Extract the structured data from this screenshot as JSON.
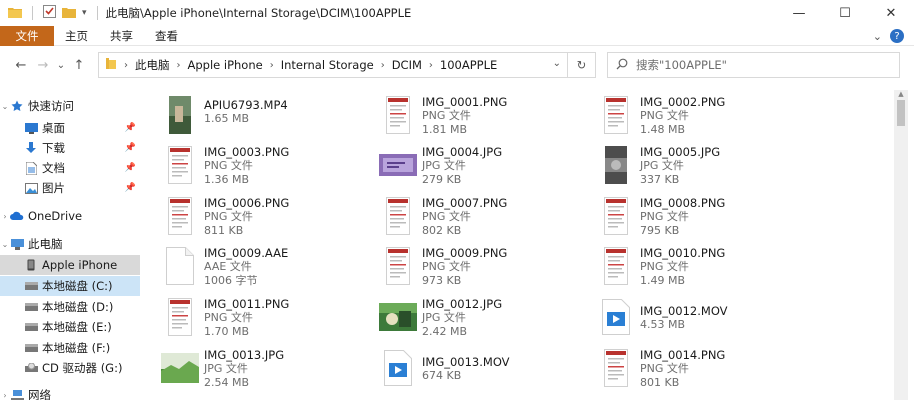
{
  "window": {
    "title": "此电脑\\Apple iPhone\\Internal Storage\\DCIM\\100APPLE",
    "controls": {
      "minimize": "—",
      "maximize": "☐",
      "close": "✕"
    }
  },
  "ribbon": {
    "file_tab": "文件",
    "tabs": [
      "主页",
      "共享",
      "查看"
    ],
    "collapse": "⌄",
    "help": "?"
  },
  "address_bar": {
    "back": "←",
    "forward": "→",
    "recent": "⌄",
    "up": "↑",
    "crumbs": [
      "此电脑",
      "Apple iPhone",
      "Internal Storage",
      "DCIM",
      "100APPLE"
    ],
    "dropdown": "⌄",
    "refresh": "↻"
  },
  "search": {
    "placeholder": "搜索\"100APPLE\""
  },
  "nav": {
    "items": [
      {
        "label": "快速访问",
        "icon": "star-icon",
        "top": 0
      },
      {
        "label": "桌面",
        "icon": "desktop-icon",
        "pinned": true
      },
      {
        "label": "下载",
        "icon": "download-icon",
        "pinned": true
      },
      {
        "label": "文档",
        "icon": "document-icon",
        "pinned": true
      },
      {
        "label": "图片",
        "icon": "pictures-icon",
        "pinned": true
      },
      {
        "label": "OneDrive",
        "icon": "cloud-icon"
      },
      {
        "label": "此电脑",
        "icon": "computer-icon"
      },
      {
        "label": "Apple iPhone",
        "icon": "phone-icon",
        "selected": true
      },
      {
        "label": "本地磁盘 (C:)",
        "icon": "drive-icon"
      },
      {
        "label": "本地磁盘 (D:)",
        "icon": "drive-icon"
      },
      {
        "label": "本地磁盘 (E:)",
        "icon": "drive-icon"
      },
      {
        "label": "本地磁盘 (F:)",
        "icon": "drive-icon"
      },
      {
        "label": "CD 驱动器 (G:)",
        "icon": "cd-drive-icon"
      },
      {
        "label": "网络",
        "icon": "network-icon"
      }
    ]
  },
  "files": [
    {
      "name": "APIU6793.MP4",
      "type": "",
      "size": "1.65 MB",
      "thumb": "video-photo"
    },
    {
      "name": "IMG_0001.PNG",
      "type": "PNG 文件",
      "size": "1.81 MB",
      "thumb": "doc"
    },
    {
      "name": "IMG_0002.PNG",
      "type": "PNG 文件",
      "size": "1.48 MB",
      "thumb": "doc"
    },
    {
      "name": "IMG_0003.PNG",
      "type": "PNG 文件",
      "size": "1.36 MB",
      "thumb": "doc"
    },
    {
      "name": "IMG_0004.JPG",
      "type": "JPG 文件",
      "size": "279 KB",
      "thumb": "purple-photo"
    },
    {
      "name": "IMG_0005.JPG",
      "type": "JPG 文件",
      "size": "337 KB",
      "thumb": "dark-photo"
    },
    {
      "name": "IMG_0006.PNG",
      "type": "PNG 文件",
      "size": "811 KB",
      "thumb": "doc"
    },
    {
      "name": "IMG_0007.PNG",
      "type": "PNG 文件",
      "size": "802 KB",
      "thumb": "doc"
    },
    {
      "name": "IMG_0008.PNG",
      "type": "PNG 文件",
      "size": "795 KB",
      "thumb": "doc"
    },
    {
      "name": "IMG_0009.AAE",
      "type": "AAE 文件",
      "size": "1006 字节",
      "thumb": "blank"
    },
    {
      "name": "IMG_0009.PNG",
      "type": "PNG 文件",
      "size": "973 KB",
      "thumb": "doc"
    },
    {
      "name": "IMG_0010.PNG",
      "type": "PNG 文件",
      "size": "1.49 MB",
      "thumb": "doc"
    },
    {
      "name": "IMG_0011.PNG",
      "type": "PNG 文件",
      "size": "1.70 MB",
      "thumb": "doc"
    },
    {
      "name": "IMG_0012.JPG",
      "type": "JPG 文件",
      "size": "2.42 MB",
      "thumb": "green-photo"
    },
    {
      "name": "IMG_0012.MOV",
      "type": "",
      "size": "4.53 MB",
      "thumb": "video"
    },
    {
      "name": "IMG_0013.JPG",
      "type": "JPG 文件",
      "size": "2.54 MB",
      "thumb": "outdoor-photo"
    },
    {
      "name": "IMG_0013.MOV",
      "type": "",
      "size": "674 KB",
      "thumb": "video"
    },
    {
      "name": "IMG_0014.PNG",
      "type": "PNG 文件",
      "size": "801 KB",
      "thumb": "doc"
    }
  ],
  "colors": {
    "file_tab": "#c3671a",
    "selected_nav": "#d9d9d9",
    "accent_folder": "#e8b43a"
  }
}
